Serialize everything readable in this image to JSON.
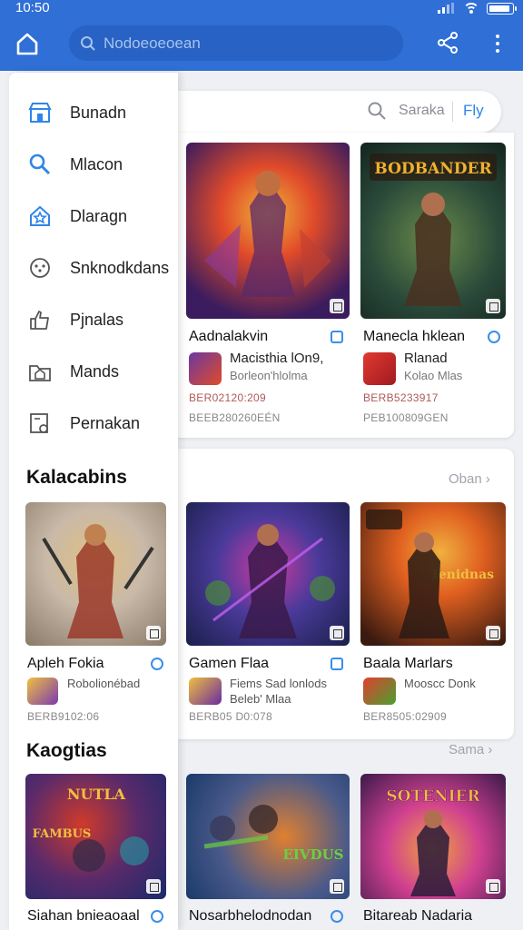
{
  "status": {
    "time": "10:50"
  },
  "search": {
    "placeholder": "Nodoeoeoean"
  },
  "drawer": {
    "items": [
      {
        "label": "Bunadn",
        "icon": "store-icon"
      },
      {
        "label": "Mlacon",
        "icon": "search-icon"
      },
      {
        "label": "Dlaragn",
        "icon": "star-house-icon"
      },
      {
        "label": "Snknodkdans",
        "icon": "gamepad-icon"
      },
      {
        "label": "Pjnalas",
        "icon": "thumbs-up-icon"
      },
      {
        "label": "Mands",
        "icon": "folder-icon"
      },
      {
        "label": "Pernakan",
        "icon": "settings-doc-icon"
      }
    ]
  },
  "filter": {
    "label": "Saraka",
    "button": "Fly"
  },
  "featured": [
    {
      "title": "Aadnalakvin",
      "sub1": "Macisthia lOn9,",
      "sub2": "Borleon'hlolma",
      "meta1": "BER02120:209",
      "meta2": "BEEB280260EÉN",
      "colors": [
        "#3b1c5e",
        "#e04a2a",
        "#f0b23a"
      ]
    },
    {
      "title": "Manecla hklean",
      "sub1": "Rlanad",
      "sub2": "Kolao Mlas",
      "meta1": "BERB5233917",
      "meta2": "PEB100809GEN",
      "colors": [
        "#1f3a30",
        "#5a7a3a",
        "#e0a030"
      ]
    }
  ],
  "sections": [
    {
      "title": "Kalacabins",
      "more": "Oban",
      "games": [
        {
          "title": "Apleh Fokia",
          "sub1": "Robolionébad",
          "sub2": "",
          "meta": "BERB9102:06",
          "colors": [
            "#c9b9a8",
            "#9a3a2a",
            "#e0c080"
          ]
        },
        {
          "title": "Gamen Flaa",
          "sub1": "Fiems Sad lonlods",
          "sub2": "Beleb' Mlaa",
          "meta": "BERB05 D0:078",
          "colors": [
            "#2a2f6a",
            "#d03aa0",
            "#4aa0e0"
          ]
        },
        {
          "title": "Baala Marlars",
          "sub1": "Mooscc Donk",
          "sub2": "",
          "meta": "BER8505:02909",
          "colors": [
            "#3a1a10",
            "#e06020",
            "#f0b040"
          ]
        }
      ]
    },
    {
      "title": "Kaogtias",
      "more": "Sama",
      "games": [
        {
          "title": "Siahan bnieaoaal",
          "colors": [
            "#1a2a6a",
            "#d03a2a",
            "#f0c040"
          ]
        },
        {
          "title": "Nosarbhelodnodan",
          "colors": [
            "#1a3a6a",
            "#e08030",
            "#6ad040"
          ]
        },
        {
          "title": "Bitareab Nadaria",
          "colors": [
            "#3a1a4a",
            "#d04090",
            "#f0a040"
          ]
        }
      ]
    }
  ],
  "colors": {
    "primary": "#2f6fd6",
    "accent": "#2f86e8"
  }
}
